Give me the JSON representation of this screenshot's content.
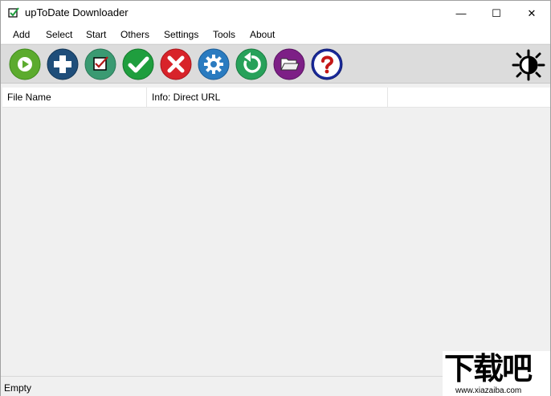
{
  "window": {
    "title": "upToDate Downloader",
    "controls": {
      "minimize": "—",
      "maximize": "☐",
      "close": "✕"
    }
  },
  "menu": {
    "items": [
      "Add",
      "Select",
      "Start",
      "Others",
      "Settings",
      "Tools",
      "About"
    ]
  },
  "toolbar": {
    "buttons": [
      {
        "icon": "play-icon",
        "color": "#5cab2e"
      },
      {
        "icon": "add-icon",
        "color": "#1f4e7a"
      },
      {
        "icon": "checkbox-icon",
        "color": "#3a9a72"
      },
      {
        "icon": "checkmark-icon",
        "color": "#1f9e3e"
      },
      {
        "icon": "cancel-icon",
        "color": "#d8232a"
      },
      {
        "icon": "settings-gear-icon",
        "color": "#2a7bc0"
      },
      {
        "icon": "refresh-icon",
        "color": "#27a15a"
      },
      {
        "icon": "folder-icon",
        "color": "#7d1f86"
      },
      {
        "icon": "help-icon",
        "color": "#1a2a9a"
      }
    ],
    "theme_icon": "theme-toggle-icon"
  },
  "list": {
    "columns": [
      "File Name",
      "Info: Direct URL",
      ""
    ]
  },
  "status": {
    "text": "Empty"
  },
  "watermark": {
    "big": "下载吧",
    "small": "www.xiazaiba.com"
  }
}
